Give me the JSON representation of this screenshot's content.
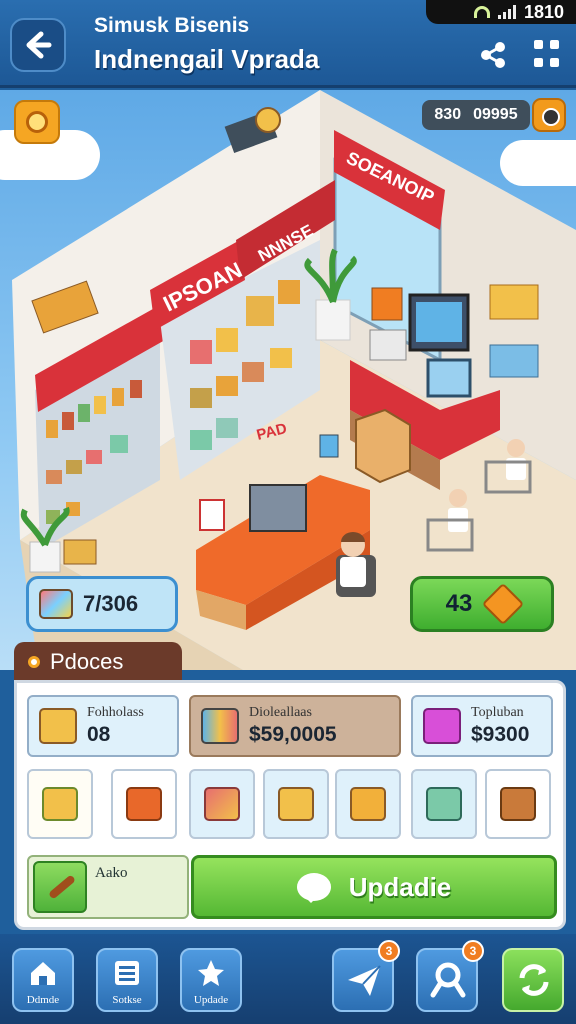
{
  "status_bar": {
    "time": "1810"
  },
  "header": {
    "subtitle": "Simusk Bisenis",
    "title": "Indnengail Vprada"
  },
  "scene": {
    "money_label": "830",
    "money_value": "09995",
    "store_sign": "SOEANOIP",
    "shelf_banner_main": "IPSOAN",
    "shelf_banner_right": "NNNSE",
    "floor_text": "PAD",
    "stat_left_value": "7/306",
    "stat_right_value": "43"
  },
  "panel": {
    "tab_label": "Pdoces",
    "cards": [
      {
        "label": "Fohholass",
        "value": "08",
        "icon": "box-icon"
      },
      {
        "label": "Dioleallaas",
        "value": "$59,0005",
        "icon": "cans-icon"
      },
      {
        "label": "Topluban",
        "value": "$9300",
        "icon": "gift-icon"
      }
    ],
    "slots": [
      {
        "name": "slot-box",
        "color": "#f2c04a"
      },
      {
        "name": "slot-table",
        "color": "#e8682a"
      },
      {
        "name": "slot-packages",
        "color": "#e76f6f"
      },
      {
        "name": "slot-crate",
        "color": "#f2c04a"
      },
      {
        "name": "slot-bag",
        "color": "#f2b03a"
      },
      {
        "name": "slot-tray",
        "color": "#7bc9a8"
      },
      {
        "name": "slot-basket",
        "color": "#c97a3a"
      }
    ],
    "tool_label": "Aako",
    "update_button": "Updadie"
  },
  "nav": {
    "items": [
      {
        "label": "Ddmde",
        "icon": "home-icon"
      },
      {
        "label": "Sotkse",
        "icon": "stats-icon"
      },
      {
        "label": "Updade",
        "icon": "star-icon"
      }
    ],
    "badges": [
      "3",
      "3"
    ]
  },
  "colors": {
    "header_blue": "#1d5896",
    "awning_red": "#d9323a",
    "update_green": "#55b834",
    "accent_orange": "#f5a623"
  }
}
